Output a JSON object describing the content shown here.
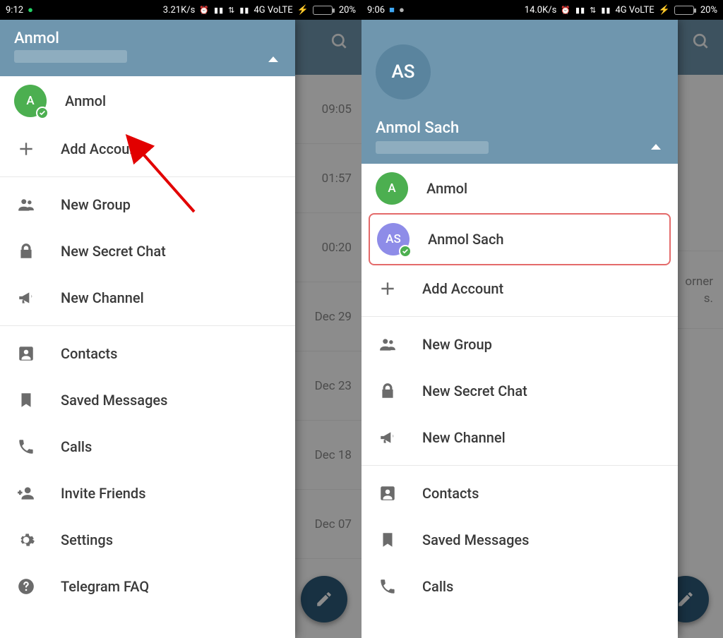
{
  "left": {
    "status": {
      "time": "9:12",
      "speed": "3.21K/s",
      "net": "4G  VoLTE",
      "battery": "20%"
    },
    "header": {
      "name": "Anmol"
    },
    "accounts": [
      {
        "initial": "A",
        "name": "Anmol",
        "color": "green",
        "checked": true
      }
    ],
    "add_account": "Add Account",
    "menu1": {
      "new_group": "New Group",
      "new_secret_chat": "New Secret Chat",
      "new_channel": "New Channel"
    },
    "menu2": {
      "contacts": "Contacts",
      "saved_messages": "Saved Messages",
      "calls": "Calls",
      "invite_friends": "Invite Friends",
      "settings": "Settings",
      "telegram_faq": "Telegram FAQ"
    },
    "bg_times": [
      "09:05",
      "01:57",
      "00:20",
      "Dec 29",
      "Dec 23",
      "Dec 18",
      "Dec 07"
    ]
  },
  "right": {
    "status": {
      "time": "9:06",
      "speed": "14.0K/s",
      "net": "4G  VoLTE",
      "battery": "20%"
    },
    "header": {
      "initials": "AS",
      "name": "Anmol Sach"
    },
    "accounts": [
      {
        "initial": "A",
        "name": "Anmol",
        "color": "green",
        "checked": false
      },
      {
        "initial": "AS",
        "name": "Anmol Sach",
        "color": "purple",
        "checked": true
      }
    ],
    "add_account": "Add Account",
    "menu1": {
      "new_group": "New Group",
      "new_secret_chat": "New Secret Chat",
      "new_channel": "New Channel"
    },
    "menu2": {
      "contacts": "Contacts",
      "saved_messages": "Saved Messages",
      "calls": "Calls"
    },
    "bg_text": [
      "orner",
      "s."
    ]
  }
}
